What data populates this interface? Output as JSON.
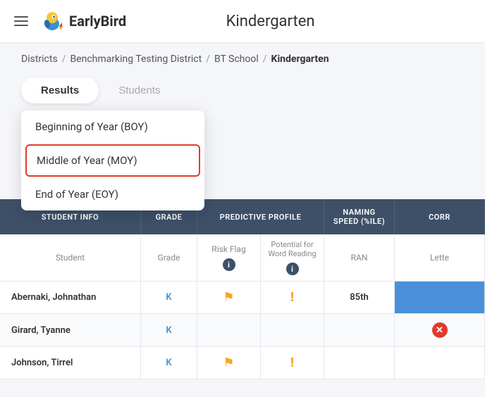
{
  "header": {
    "logo_text": "EarlyBird",
    "page_title": "Kindergarten",
    "menu_icon": "hamburger-icon"
  },
  "breadcrumb": {
    "items": [
      {
        "label": "Districts",
        "active": false
      },
      {
        "label": "Benchmarking Testing District",
        "active": false
      },
      {
        "label": "BT School",
        "active": false
      },
      {
        "label": "Kindergarten",
        "active": true
      }
    ]
  },
  "tabs": [
    {
      "label": "Results",
      "active": true
    },
    {
      "label": "Students",
      "active": false
    }
  ],
  "dropdown": {
    "items": [
      {
        "label": "Beginning of Year (BOY)",
        "highlighted": false
      },
      {
        "label": "Middle of Year (MOY)",
        "highlighted": true
      },
      {
        "label": "End of Year (EOY)",
        "highlighted": false
      }
    ]
  },
  "table": {
    "columns": [
      {
        "label": "STUDENT INFO"
      },
      {
        "label": "GRADE"
      },
      {
        "label": "PREDICTIVE PROFILE"
      },
      {
        "label": "NAMING SPEED (%ILE)"
      },
      {
        "label": "CORR"
      }
    ],
    "sub_columns": {
      "student": "Student",
      "grade": "Grade",
      "risk_flag": "Risk Flag",
      "potential": "Potential for Word Reading",
      "ran": "RAN",
      "letter": "Lette"
    },
    "rows": [
      {
        "student": "Abernaki, Johnathan",
        "grade": "K",
        "risk_flag": "yellow_flag",
        "potential": "exclaim",
        "naming": "85th",
        "corr": "blue"
      },
      {
        "student": "Girard, Tyanne",
        "grade": "K",
        "risk_flag": "",
        "potential": "",
        "naming": "",
        "corr": "x"
      },
      {
        "student": "Johnson, Tirrel",
        "grade": "K",
        "risk_flag": "yellow_flag",
        "potential": "exclaim",
        "naming": "",
        "corr": ""
      }
    ]
  }
}
